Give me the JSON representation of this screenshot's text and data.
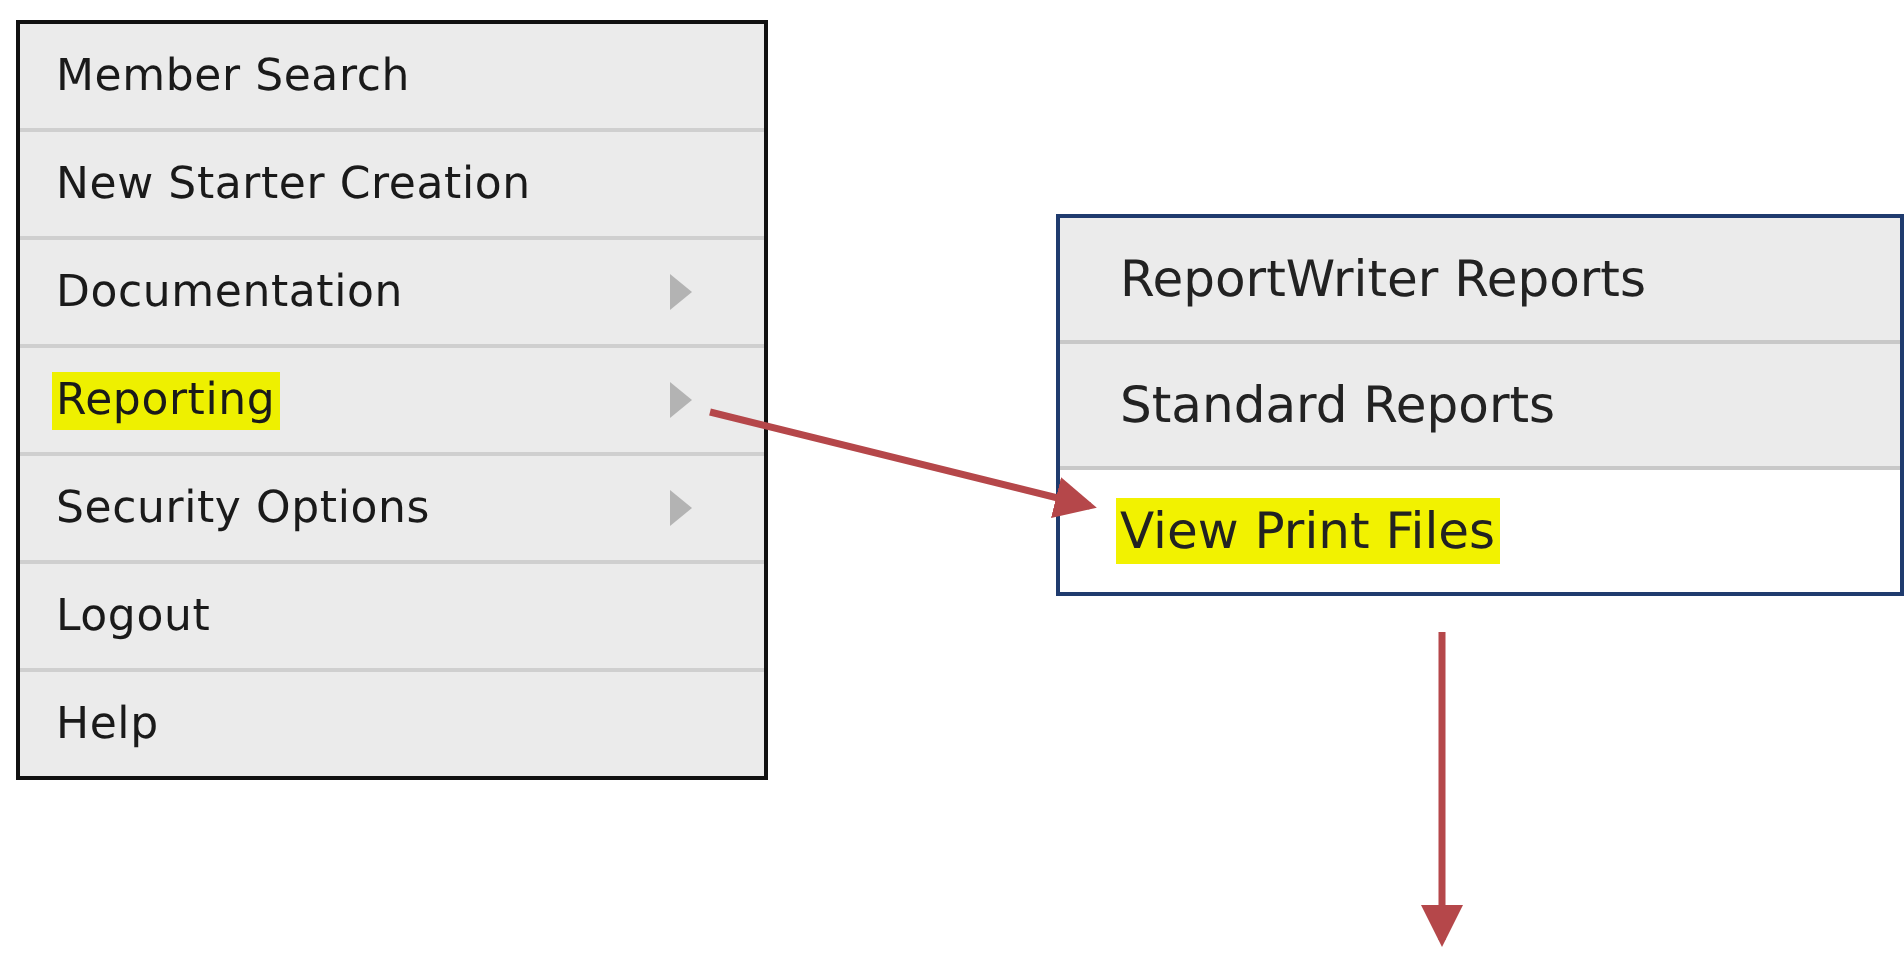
{
  "menu": {
    "items": [
      {
        "label": "Member Search",
        "has_submenu": false,
        "highlighted": false
      },
      {
        "label": "New Starter Creation",
        "has_submenu": false,
        "highlighted": false
      },
      {
        "label": "Documentation",
        "has_submenu": true,
        "highlighted": false
      },
      {
        "label": "Reporting",
        "has_submenu": true,
        "highlighted": true
      },
      {
        "label": "Security Options",
        "has_submenu": true,
        "highlighted": false
      },
      {
        "label": "Logout",
        "has_submenu": false,
        "highlighted": false
      },
      {
        "label": "Help",
        "has_submenu": false,
        "highlighted": false
      }
    ]
  },
  "submenu": {
    "items": [
      {
        "label": "ReportWriter Reports",
        "highlighted": false,
        "selected": false
      },
      {
        "label": "Standard Reports",
        "highlighted": false,
        "selected": false
      },
      {
        "label": "View Print Files",
        "highlighted": true,
        "selected": true
      }
    ]
  }
}
